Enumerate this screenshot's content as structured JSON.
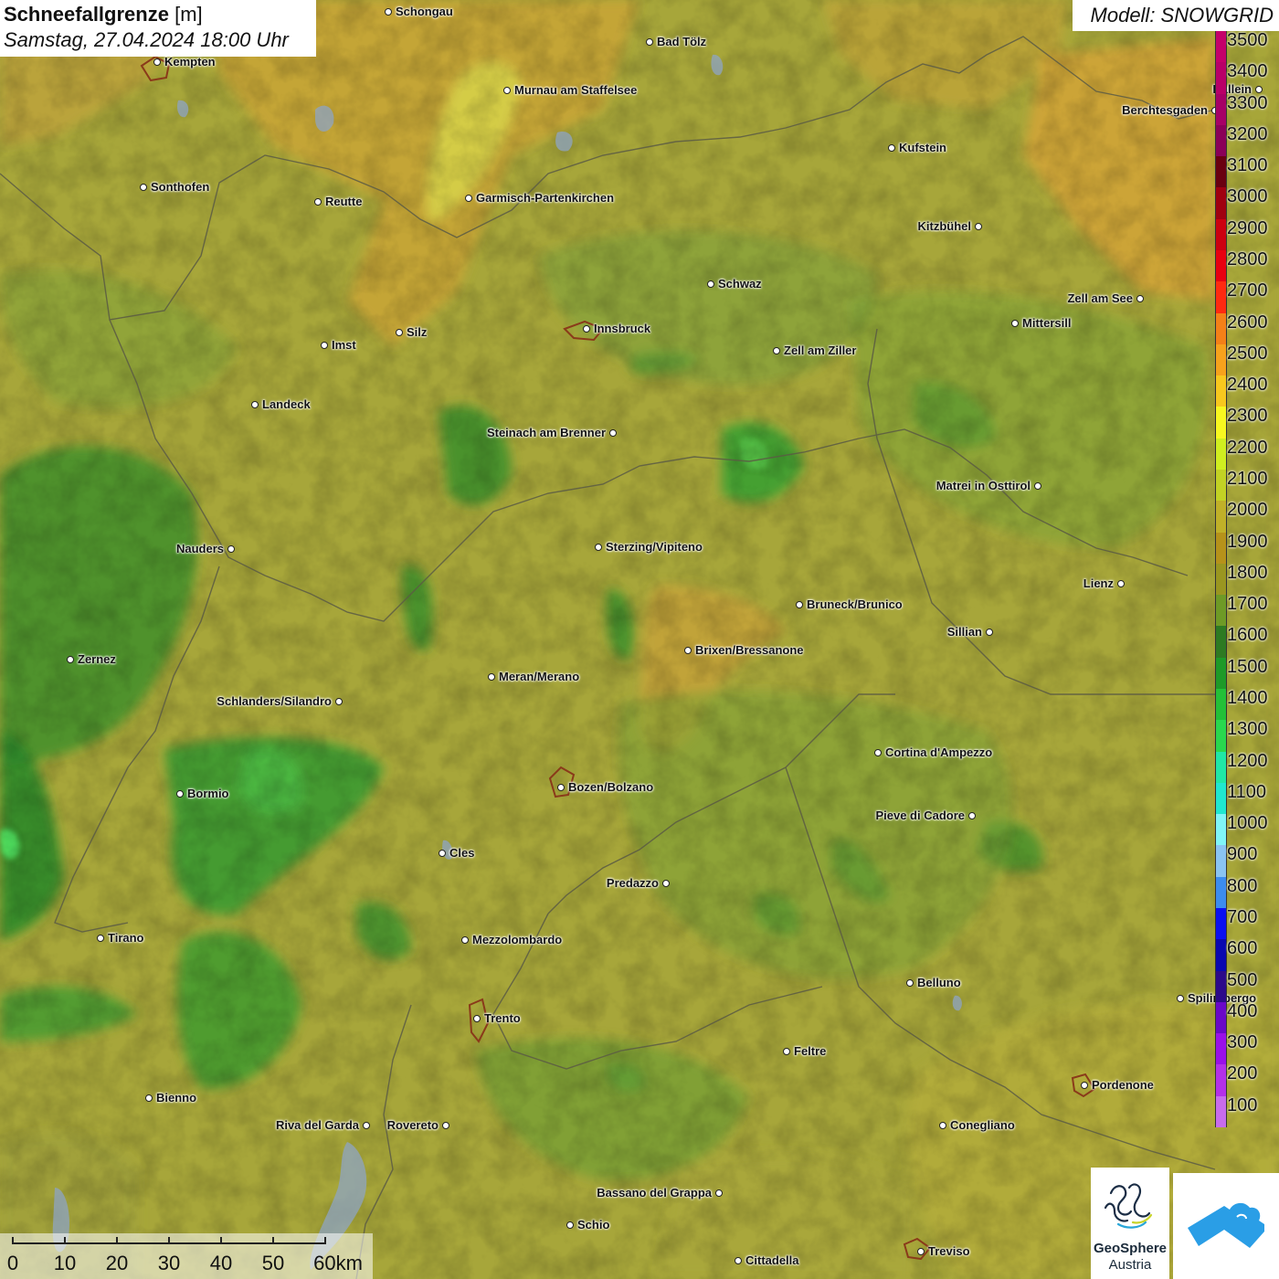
{
  "header": {
    "title": "Schneefallgrenze",
    "unit": "[m]",
    "datetime": "Samstag, 27.04.2024 18:00 Uhr"
  },
  "model": {
    "label": "Modell: SNOWGRID"
  },
  "legend": {
    "levels": [
      "3500",
      "3400",
      "3300",
      "3200",
      "3100",
      "3000",
      "2900",
      "2800",
      "2700",
      "2600",
      "2500",
      "2400",
      "2300",
      "2200",
      "2100",
      "2000",
      "1900",
      "1800",
      "1700",
      "1600",
      "1500",
      "1400",
      "1300",
      "1200",
      "1100",
      "1000",
      "900",
      "800",
      "700",
      "600",
      "500",
      "400",
      "300",
      "200",
      "100"
    ],
    "colors": [
      "#c4006a",
      "#b80068",
      "#a60066",
      "#8a0058",
      "#6a0010",
      "#a00010",
      "#cc0010",
      "#e80010",
      "#ff2a10",
      "#f48018",
      "#f7a21c",
      "#f8c81e",
      "#f8f820",
      "#d0ee20",
      "#c2d224",
      "#c0b028",
      "#b6921a",
      "#9a9620",
      "#6e9a26",
      "#2e7a22",
      "#1e9a28",
      "#24c038",
      "#2ad84e",
      "#20e8a6",
      "#20e8d0",
      "#80f6f8",
      "#8ac4f2",
      "#3c8cee",
      "#0a10f0",
      "#0a08b0",
      "#2c0a8a",
      "#6a08c8",
      "#9a10e8",
      "#b430e8",
      "#c86cec"
    ]
  },
  "places": [
    {
      "name": "Schongau",
      "side": "right"
    },
    {
      "name": "Kempten",
      "side": "right"
    },
    {
      "name": "Bad Tölz",
      "side": "right"
    },
    {
      "name": "Murnau am Staffelsee",
      "side": "right"
    },
    {
      "name": "Berchtesgaden",
      "side": "left"
    },
    {
      "name": "Hallein",
      "side": "left"
    },
    {
      "name": "Kufstein",
      "side": "right"
    },
    {
      "name": "Sonthofen",
      "side": "right"
    },
    {
      "name": "Reutte",
      "side": "right"
    },
    {
      "name": "Garmisch-Partenkirchen",
      "side": "right"
    },
    {
      "name": "Kitzbühel",
      "side": "left"
    },
    {
      "name": "Schwaz",
      "side": "right"
    },
    {
      "name": "Zell am See",
      "side": "left"
    },
    {
      "name": "Innsbruck",
      "side": "right"
    },
    {
      "name": "Mittersill",
      "side": "right"
    },
    {
      "name": "Imst",
      "side": "right"
    },
    {
      "name": "Silz",
      "side": "right"
    },
    {
      "name": "Zell am Ziller",
      "side": "right"
    },
    {
      "name": "Landeck",
      "side": "right"
    },
    {
      "name": "Steinach am Brenner",
      "side": "left"
    },
    {
      "name": "Matrei in Osttirol",
      "side": "left"
    },
    {
      "name": "Nauders",
      "side": "left"
    },
    {
      "name": "Sterzing/Vipiteno",
      "side": "right"
    },
    {
      "name": "Lienz",
      "side": "left"
    },
    {
      "name": "Bruneck/Brunico",
      "side": "right"
    },
    {
      "name": "Sillian",
      "side": "left"
    },
    {
      "name": "Zernez",
      "side": "right"
    },
    {
      "name": "Brixen/Bressanone",
      "side": "right"
    },
    {
      "name": "Meran/Merano",
      "side": "right"
    },
    {
      "name": "Schlanders/Silandro",
      "side": "left"
    },
    {
      "name": "Cortina d'Ampezzo",
      "side": "right"
    },
    {
      "name": "Bozen/Bolzano",
      "side": "right"
    },
    {
      "name": "Bormio",
      "side": "right"
    },
    {
      "name": "Pieve di Cadore",
      "side": "left"
    },
    {
      "name": "Cles",
      "side": "right"
    },
    {
      "name": "Predazzo",
      "side": "left"
    },
    {
      "name": "Tirano",
      "side": "right"
    },
    {
      "name": "Mezzolombardo",
      "side": "right"
    },
    {
      "name": "Belluno",
      "side": "right"
    },
    {
      "name": "Spilimbergo",
      "side": "right"
    },
    {
      "name": "Trento",
      "side": "right"
    },
    {
      "name": "Feltre",
      "side": "right"
    },
    {
      "name": "Pordenone",
      "side": "right"
    },
    {
      "name": "Bienno",
      "side": "right"
    },
    {
      "name": "Riva del Garda",
      "side": "left"
    },
    {
      "name": "Rovereto",
      "side": "left"
    },
    {
      "name": "Conegliano",
      "side": "right"
    },
    {
      "name": "Bassano del Grappa",
      "side": "left"
    },
    {
      "name": "Schio",
      "side": "right"
    },
    {
      "name": "Cittadella",
      "side": "right"
    },
    {
      "name": "Treviso",
      "side": "right"
    }
  ],
  "scalebar": {
    "labels": [
      "0",
      "10",
      "20",
      "30",
      "40",
      "50",
      "60km"
    ]
  },
  "logos": {
    "geosphere_line1": "GeoSphere",
    "geosphere_line2": "Austria"
  },
  "colors": {
    "olive_base": "#a8a83a",
    "green_low": "#6e9a2e",
    "green_mid": "#3a8a2a",
    "green_bright": "#2ec03a",
    "orange_high": "#d4a534",
    "yellow_high": "#d8d040"
  }
}
